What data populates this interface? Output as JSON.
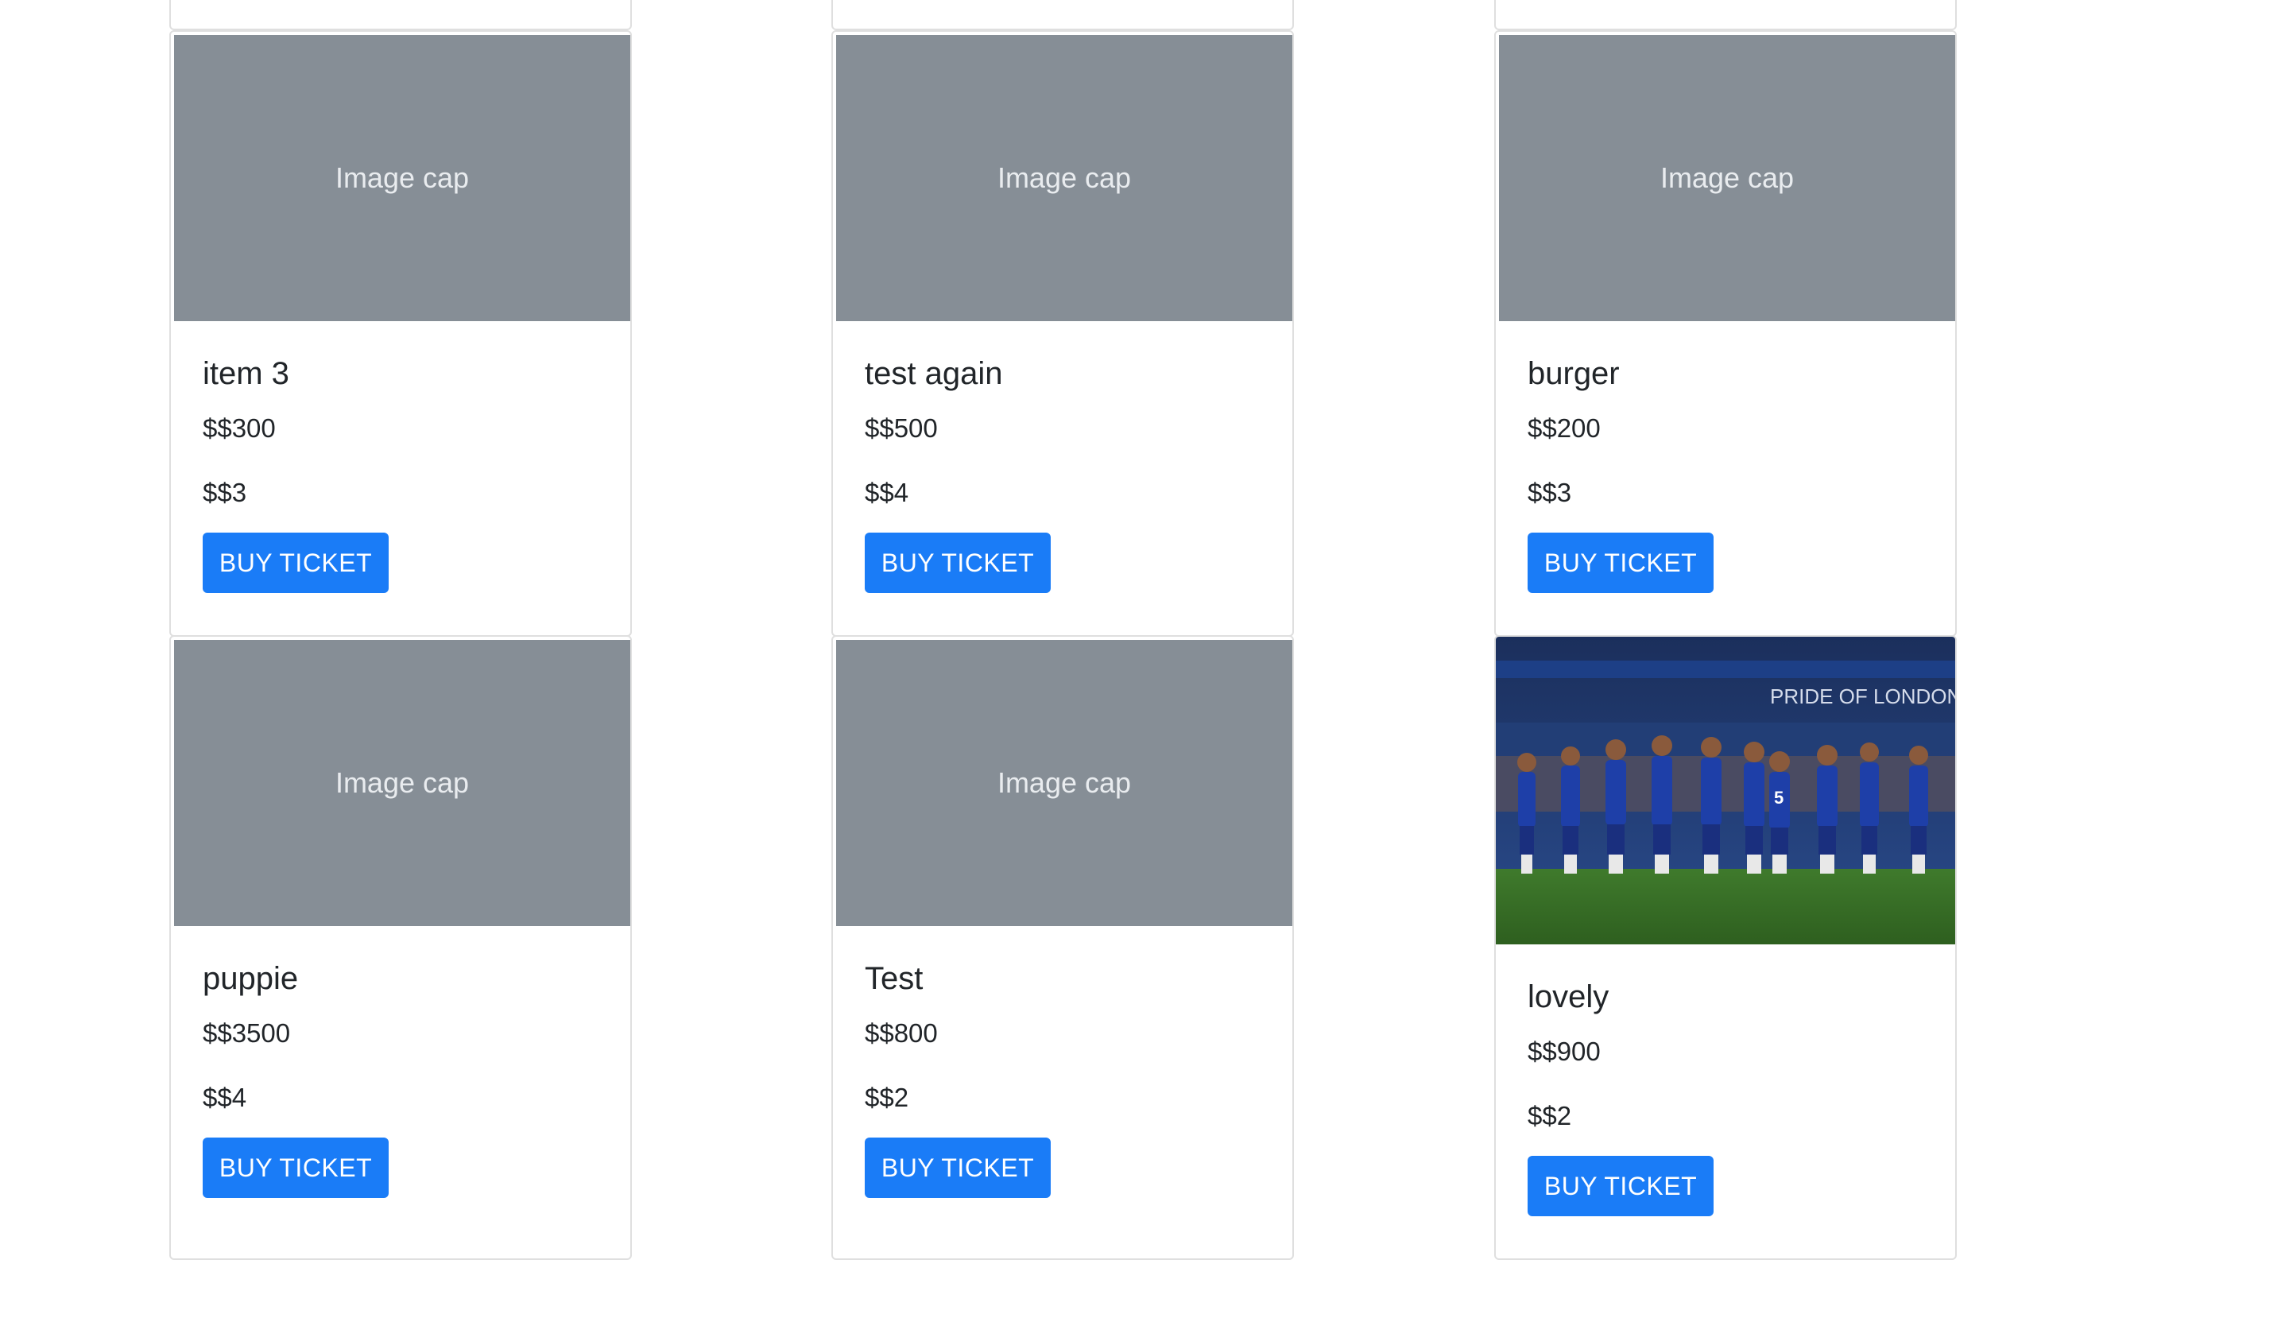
{
  "image_cap_text": "Image cap",
  "button_label": "BUY TICKET",
  "cards": [
    {
      "title": "item 3",
      "price": "$$300",
      "quantity": "$$3"
    },
    {
      "title": "test again",
      "price": "$$500",
      "quantity": "$$4"
    },
    {
      "title": "burger",
      "price": "$$200",
      "quantity": "$$3"
    },
    {
      "title": "puppie",
      "price": "$$3500",
      "quantity": "$$4"
    },
    {
      "title": "Test",
      "price": "$$800",
      "quantity": "$$2"
    },
    {
      "title": "lovely",
      "price": "$$900",
      "quantity": "$$2",
      "photo_banner": "PRIDE OF LONDON"
    }
  ],
  "colors": {
    "button": "#1a7cf7",
    "image_cap_bg": "#868e96",
    "card_border": "#dfdfdf"
  }
}
